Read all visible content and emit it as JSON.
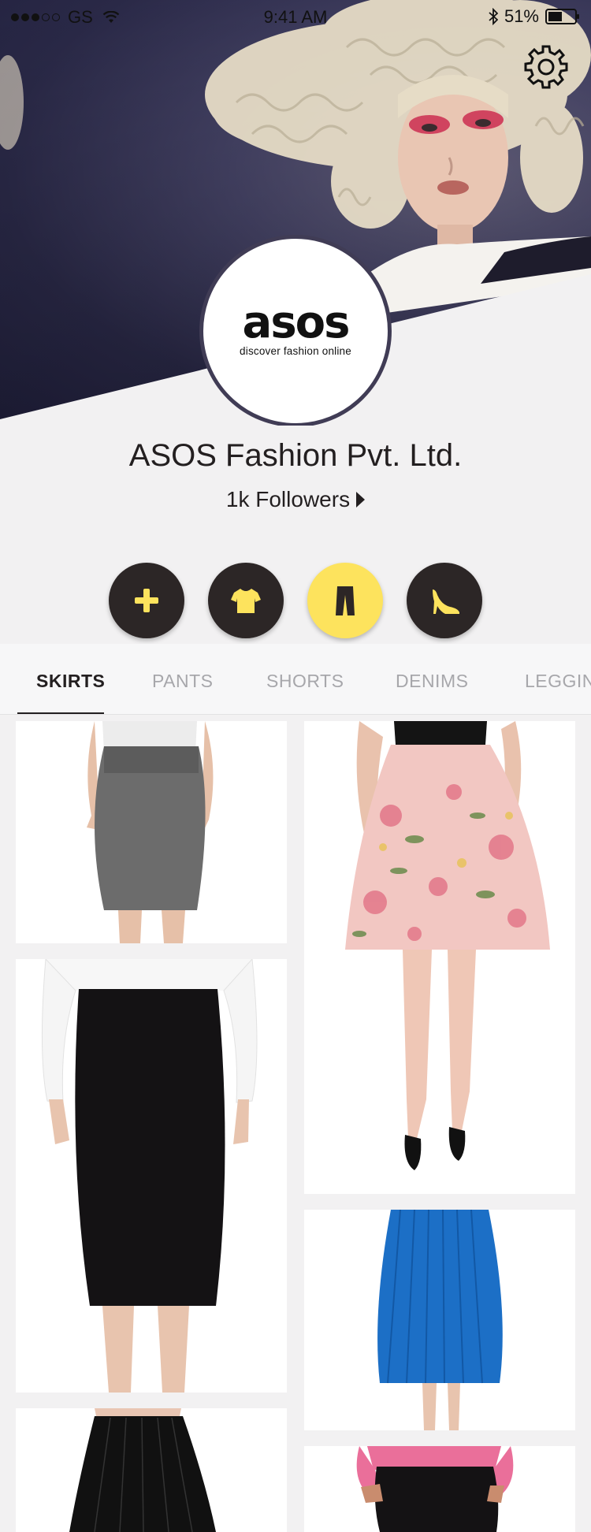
{
  "status_bar": {
    "carrier": "GS",
    "time": "9:41 AM",
    "battery": "51%"
  },
  "store": {
    "logo_word": "asos",
    "logo_tagline": "discover fashion online",
    "name": "ASOS Fashion Pvt. Ltd.",
    "followers": "1k Followers"
  },
  "categories": [
    {
      "icon": "plus-icon",
      "active": false
    },
    {
      "icon": "tshirt-icon",
      "active": false
    },
    {
      "icon": "pants-icon",
      "active": true
    },
    {
      "icon": "high-heel-icon",
      "active": false
    }
  ],
  "tabs": [
    "SKIRTS",
    "PANTS",
    "SHORTS",
    "DENIMS",
    "LEGGINGS"
  ],
  "active_tab": "SKIRTS",
  "products": [
    {
      "name": "grey pencil skirt"
    },
    {
      "name": "pink floral skater skirt"
    },
    {
      "name": "black pencil skirt"
    },
    {
      "name": "blue pleated midi skirt"
    },
    {
      "name": "black pleated skirt"
    },
    {
      "name": "black skirt with pink top"
    }
  ],
  "colors": {
    "accent": "#fde35d",
    "dark": "#2c2626",
    "background": "#f2f1f2"
  }
}
